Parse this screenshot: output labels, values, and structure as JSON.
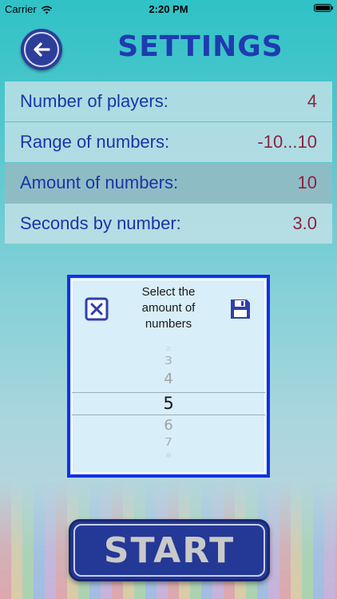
{
  "status_bar": {
    "carrier": "Carrier",
    "time": "2:20 PM"
  },
  "header": {
    "title": "SETTINGS"
  },
  "settings": [
    {
      "label": "Number of players:",
      "value": "4"
    },
    {
      "label": "Range of numbers:",
      "value": "-10...10"
    },
    {
      "label": "Amount of numbers:",
      "value": "10"
    },
    {
      "label": "Seconds by number:",
      "value": "3.0"
    }
  ],
  "picker": {
    "title_lines": [
      "Select the",
      "amount of",
      "numbers"
    ],
    "options": [
      "2",
      "3",
      "4",
      "5",
      "6",
      "7",
      "8"
    ],
    "selected": "5"
  },
  "start_button": {
    "label": "START"
  },
  "colors": {
    "title_blue": "#1f3bb0",
    "label_blue": "#1b35a8",
    "value_red": "#8c2340",
    "dialog_border": "#1330e6",
    "button_navy": "#243896"
  },
  "icons": {
    "back": "arrow-left-icon",
    "cancel": "close-box-icon",
    "save": "floppy-disk-icon",
    "wifi": "wifi-icon",
    "battery": "battery-icon"
  }
}
